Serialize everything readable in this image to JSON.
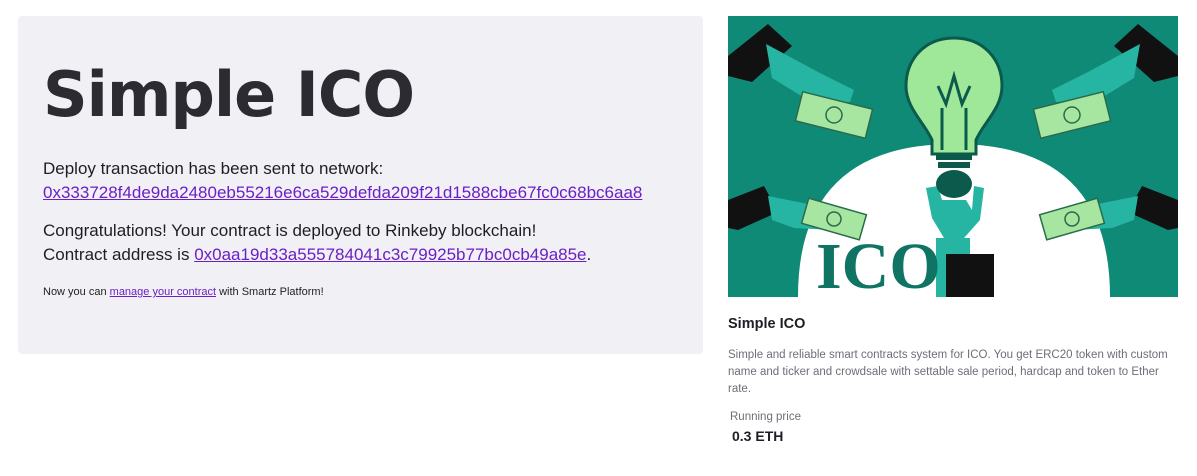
{
  "deploy": {
    "title": "Simple ICO",
    "sent_text": "Deploy transaction has been sent to network:",
    "tx_hash": "0x333728f4de9da2480eb55216e6ca529defda209f21d1588cbe67fc0c68bc6aa8",
    "congrats_text": "Congratulations! Your contract is deployed to Rinkeby blockchain!",
    "address_prefix": "Contract address is ",
    "contract_address": "0x0aa19d33a555784041c3c79925b77bc0cb49a85e",
    "address_suffix": ".",
    "manage_prefix": "Now you can ",
    "manage_link": "manage your contract",
    "manage_suffix": " with Smartz Platform!"
  },
  "card": {
    "image_text": "ICO",
    "title": "Simple ICO",
    "description": "Simple and reliable smart contracts system for ICO. You get ERC20 token with custom name and ticker and crowdsale with settable sale period, hardcap and token to Ether rate.",
    "price_label": "Running price",
    "price_value": "0.3 ETH"
  },
  "colors": {
    "panel_bg": "#f1f0f5",
    "link": "#6a1fc7",
    "illustration_bg": "#0f8a76",
    "bulb": "#9fe89a",
    "hand": "#27b5a3"
  }
}
